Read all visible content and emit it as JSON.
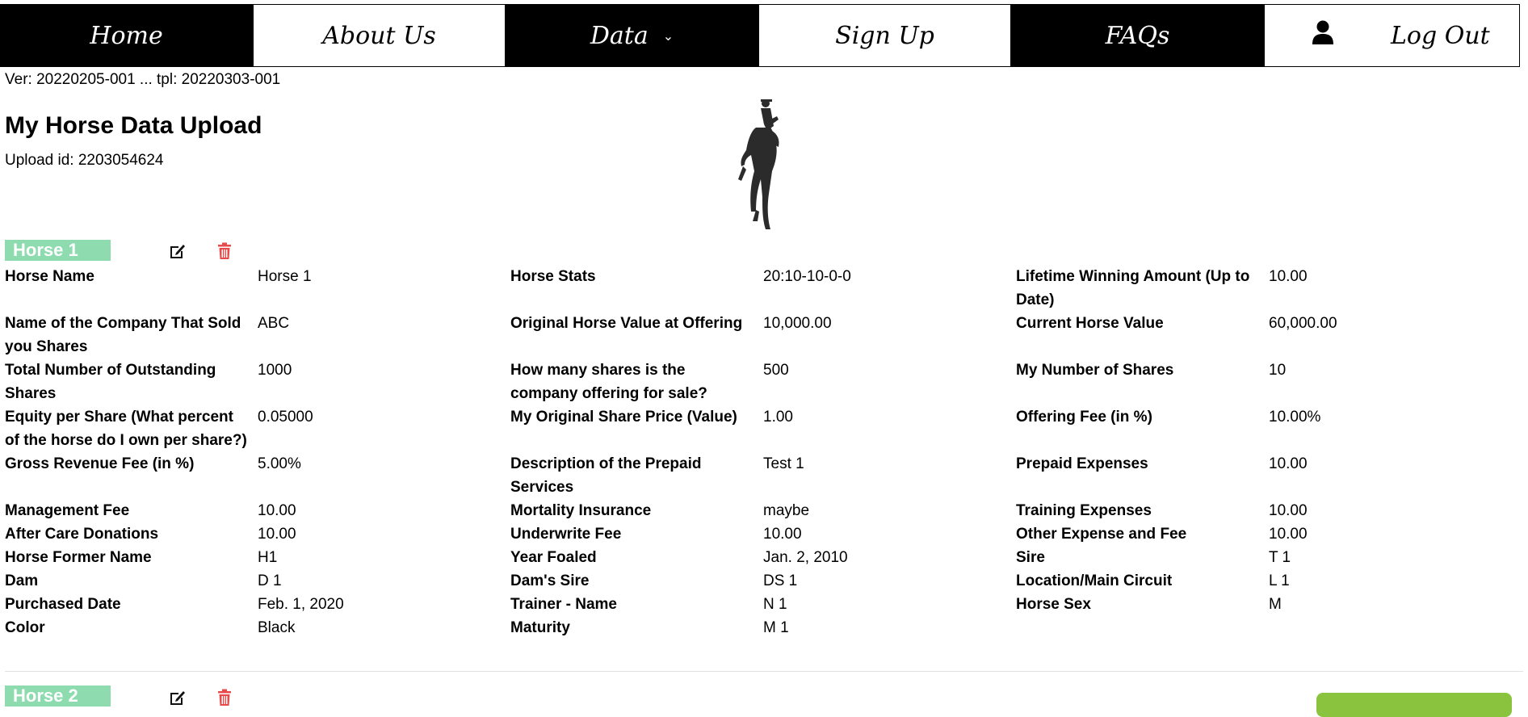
{
  "nav": {
    "home": "Home",
    "about": "About Us",
    "data": "Data",
    "signup": "Sign Up",
    "faqs": "FAQs",
    "logout": "Log Out"
  },
  "version": "Ver: 20220205-001 ... tpl: 20220303-001",
  "page": {
    "title": "My Horse Data Upload",
    "upload_id": "Upload id: 2203054624"
  },
  "horses": [
    {
      "tag": "Horse 1",
      "rows": [
        [
          {
            "l": "Horse Name",
            "v": "Horse 1"
          },
          {
            "l": "Horse Stats",
            "v": "20:10-10-0-0"
          },
          {
            "l": "Lifetime Winning Amount (Up to Date)",
            "v": "10.00"
          }
        ],
        [
          {
            "l": "Name of the Company That Sold you Shares",
            "v": "ABC"
          },
          {
            "l": "Original Horse Value at Offering",
            "v": "10,000.00"
          },
          {
            "l": "Current Horse Value",
            "v": "60,000.00"
          }
        ],
        [
          {
            "l": "Total Number of Outstanding Shares",
            "v": "1000"
          },
          {
            "l": "How many shares is the company offering for sale?",
            "v": "500"
          },
          {
            "l": "My Number of Shares",
            "v": "10"
          }
        ],
        [
          {
            "l": "Equity per Share (What percent of the horse do I own per share?)",
            "v": "0.05000"
          },
          {
            "l": "My Original Share Price (Value)",
            "v": "1.00"
          },
          {
            "l": "Offering Fee (in %)",
            "v": "10.00%"
          }
        ],
        [
          {
            "l": "Gross Revenue Fee (in %)",
            "v": "5.00%"
          },
          {
            "l": "Description of the Prepaid Services",
            "v": "Test 1"
          },
          {
            "l": "Prepaid Expenses",
            "v": "10.00"
          }
        ],
        [
          {
            "l": "Management Fee",
            "v": "10.00"
          },
          {
            "l": "Mortality Insurance",
            "v": "maybe"
          },
          {
            "l": "Training Expenses",
            "v": "10.00"
          }
        ],
        [
          {
            "l": "After Care Donations",
            "v": "10.00"
          },
          {
            "l": "Underwrite Fee",
            "v": "10.00"
          },
          {
            "l": "Other Expense and Fee",
            "v": "10.00"
          }
        ],
        [
          {
            "l": "Horse Former Name",
            "v": "H1"
          },
          {
            "l": "Year Foaled",
            "v": "Jan. 2, 2010"
          },
          {
            "l": "Sire",
            "v": "T 1"
          }
        ],
        [
          {
            "l": "Dam",
            "v": "D 1"
          },
          {
            "l": "Dam's Sire",
            "v": "DS 1"
          },
          {
            "l": "Location/Main Circuit",
            "v": "L 1"
          }
        ],
        [
          {
            "l": "Purchased Date",
            "v": "Feb. 1, 2020"
          },
          {
            "l": "Trainer - Name",
            "v": "N 1"
          },
          {
            "l": "Horse Sex",
            "v": "M"
          }
        ],
        [
          {
            "l": "Color",
            "v": "Black"
          },
          {
            "l": "Maturity",
            "v": "M 1"
          },
          {
            "l": "",
            "v": ""
          }
        ]
      ]
    },
    {
      "tag": "Horse 2"
    }
  ],
  "colors": {
    "tag_bg": "#8ddbaf",
    "trash": "#e84a4a",
    "action_green": "#8ac43e"
  },
  "icons": {
    "edit": "edit-icon",
    "trash": "trash-icon",
    "user": "user-icon",
    "chevron": "chevron-down-icon"
  }
}
